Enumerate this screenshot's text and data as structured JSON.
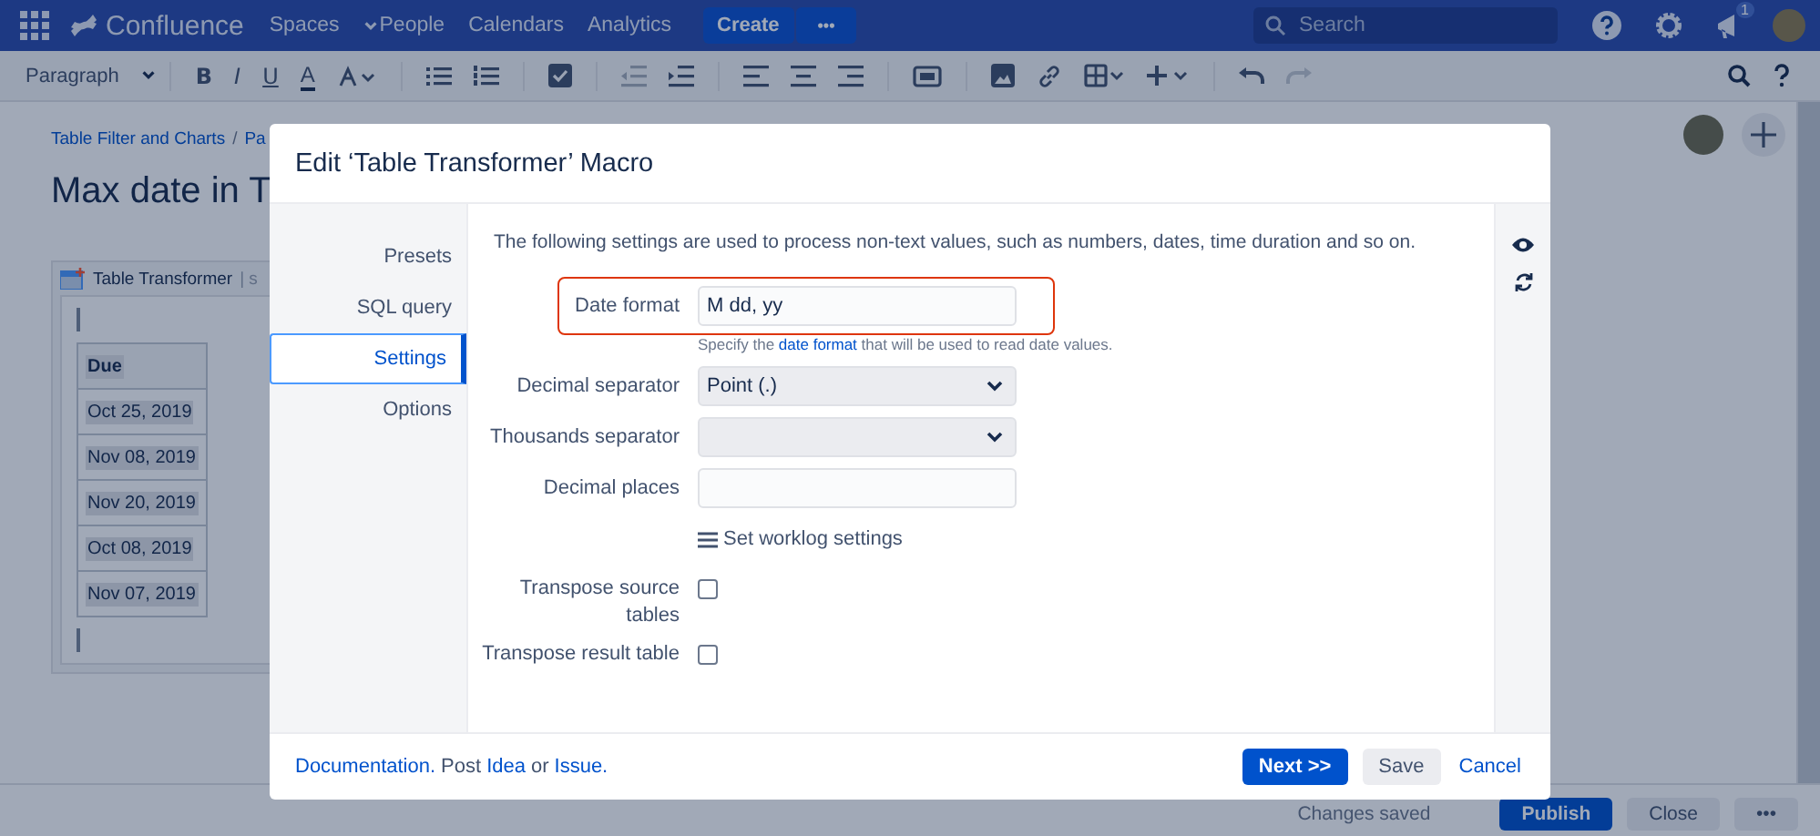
{
  "nav": {
    "logo": "Confluence",
    "menu": [
      {
        "label": "Spaces",
        "dropdown": true
      },
      {
        "label": "People",
        "dropdown": false
      },
      {
        "label": "Calendars",
        "dropdown": false
      },
      {
        "label": "Analytics",
        "dropdown": false
      }
    ],
    "create": "Create",
    "more": "•••",
    "search": {
      "placeholder": "Search"
    },
    "notification_count": "1"
  },
  "toolbar": {
    "paragraph": "Paragraph",
    "format": [
      "B",
      "I",
      "U"
    ],
    "text_color": "A"
  },
  "page": {
    "breadcrumbs": [
      "Table Filter and Charts",
      "/",
      "Pa"
    ],
    "title": "Max date in T",
    "macro": {
      "title": "Table Transformer",
      "params": "| s",
      "header": "Due",
      "rows": [
        "Oct 25, 2019",
        "Nov 08, 2019",
        "Nov 20, 2019",
        "Oct 08, 2019",
        "Nov 07, 2019"
      ]
    }
  },
  "modal": {
    "title": "Edit ‘Table Transformer’ Macro",
    "nav": [
      {
        "label": "Presets",
        "selected": false
      },
      {
        "label": "SQL query",
        "selected": false
      },
      {
        "label": "Settings",
        "selected": true
      },
      {
        "label": "Options",
        "selected": false
      }
    ],
    "intro": "The following settings are used to process non-text values, such as numbers, dates, time duration and so on.",
    "fields": [
      {
        "kind": "text",
        "label": "Date format",
        "value": "M dd, yy",
        "highlighted": true,
        "hint": {
          "before": "Specify the ",
          "link": "date format",
          "after": " that will be used to read date values."
        }
      },
      {
        "kind": "select",
        "label": "Decimal separator",
        "value": "Point (.)",
        "highlighted": false
      },
      {
        "kind": "select",
        "label": "Thousands separator",
        "highlighted": false
      },
      {
        "kind": "text",
        "label": "Decimal places",
        "highlighted": false
      },
      {
        "kind": "link",
        "label": "Set worklog settings"
      },
      {
        "kind": "checkbox",
        "label": "Transpose source tables",
        "checked": false
      },
      {
        "kind": "checkbox",
        "label": "Transpose result table",
        "checked": false
      }
    ],
    "footer": [
      {
        "kind": "link",
        "text": "Documentation."
      },
      {
        "kind": "text",
        "text": "Post"
      },
      {
        "kind": "link",
        "text": "Idea"
      },
      {
        "kind": "text",
        "text": "or"
      },
      {
        "kind": "link",
        "text": "Issue."
      }
    ],
    "buttons": [
      {
        "label": "Next >>",
        "kind": "primary"
      },
      {
        "label": "Save",
        "kind": "default"
      },
      {
        "label": "Cancel",
        "kind": "link"
      }
    ]
  },
  "bottom_bar": {
    "status": "Changes saved",
    "buttons": [
      {
        "label": "Publish",
        "kind": "primary"
      },
      {
        "label": "Close",
        "kind": "default"
      },
      {
        "label": "•••",
        "kind": "default"
      }
    ]
  }
}
